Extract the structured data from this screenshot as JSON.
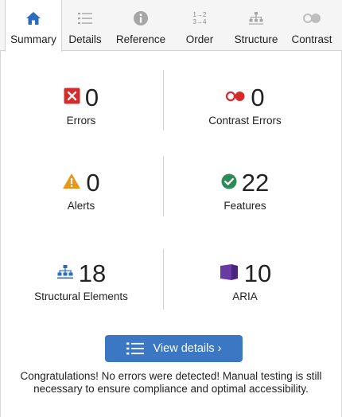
{
  "tabs": [
    {
      "label": "Summary",
      "icon": "home-icon",
      "active": true
    },
    {
      "label": "Details",
      "icon": "list-icon"
    },
    {
      "label": "Reference",
      "icon": "info-icon"
    },
    {
      "label": "Order",
      "icon": "order-icon",
      "icon_text_top": "1→2",
      "icon_text_bottom": "3→4"
    },
    {
      "label": "Structure",
      "icon": "structure-icon"
    },
    {
      "label": "Contrast",
      "icon": "contrast-icon"
    }
  ],
  "stats": {
    "errors": {
      "value": "0",
      "label": "Errors",
      "icon": "error-x-icon",
      "color": "#d62b2b"
    },
    "contrast_errors": {
      "value": "0",
      "label": "Contrast Errors",
      "icon": "contrast-error-icon",
      "color": "#d62b2b"
    },
    "alerts": {
      "value": "0",
      "label": "Alerts",
      "icon": "alert-triangle-icon",
      "color": "#e8961b"
    },
    "features": {
      "value": "22",
      "label": "Features",
      "icon": "check-circle-icon",
      "color": "#2f8a5a"
    },
    "structural": {
      "value": "18",
      "label": "Structural Elements",
      "icon": "structure-icon",
      "color": "#2d6bbd"
    },
    "aria": {
      "value": "10",
      "label": "ARIA",
      "icon": "aria-icon",
      "color": "#6a3aa3"
    }
  },
  "view_details": {
    "label": "View details ›",
    "icon": "list-icon"
  },
  "message": "Congratulations! No errors were detected! Manual testing is still necessary to ensure compliance and optimal accessibility.",
  "colors": {
    "accent": "#3c77c3",
    "tab_active_icon": "#2d6bbd",
    "tab_icon": "#9a9a9a"
  }
}
